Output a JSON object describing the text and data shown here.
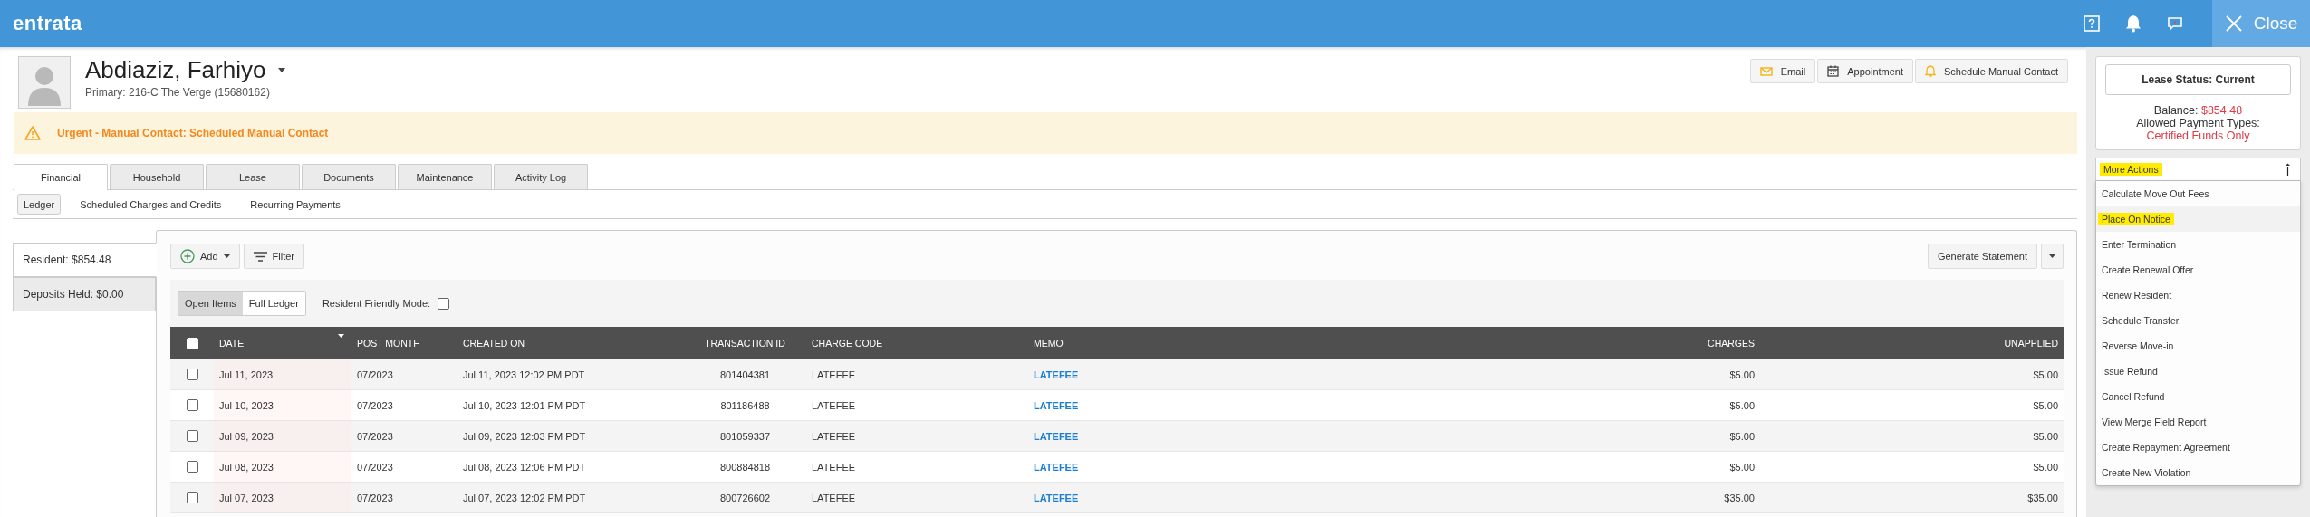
{
  "app_header": {
    "logo": "entrata",
    "close_label": "Close"
  },
  "resident": {
    "name": "Abdiaziz, Farhiyo",
    "primary": "Primary: 216-C The Verge (15680162)"
  },
  "contact_buttons": [
    {
      "kind": "email",
      "label": "Email"
    },
    {
      "kind": "calendar",
      "label": "Appointment"
    },
    {
      "kind": "bell",
      "label": "Schedule Manual Contact"
    }
  ],
  "alert": "Urgent - Manual Contact: Scheduled Manual Contact",
  "tabs": [
    {
      "label": "Financial",
      "selected": true
    },
    {
      "label": "Household",
      "selected": false
    },
    {
      "label": "Lease",
      "selected": false
    },
    {
      "label": "Documents",
      "selected": false
    },
    {
      "label": "Maintenance",
      "selected": false
    },
    {
      "label": "Activity Log",
      "selected": false
    }
  ],
  "subtabs": [
    {
      "label": "Ledger",
      "selected": true
    },
    {
      "label": "Scheduled Charges and Credits",
      "selected": false
    },
    {
      "label": "Recurring Payments",
      "selected": false
    }
  ],
  "balances": [
    {
      "label": "Resident: $854.48",
      "selected": true
    },
    {
      "label": "Deposits Held: $0.00",
      "selected": false
    }
  ],
  "toolbar": {
    "add": "Add",
    "filter": "Filter",
    "generate": "Generate Statement"
  },
  "ledger_toggle": [
    {
      "label": "Open Items",
      "selected": true
    },
    {
      "label": "Full Ledger",
      "selected": false
    }
  ],
  "resident_friendly_mode": {
    "label": "Resident Friendly Mode:",
    "checked": false
  },
  "table": {
    "select_all_checked": false,
    "columns": [
      "DATE",
      "POST MONTH",
      "CREATED ON",
      "TRANSACTION ID",
      "CHARGE CODE",
      "MEMO",
      "CHARGES",
      "UNAPPLIED"
    ],
    "rows": [
      {
        "checked": false,
        "cells": [
          "Jul 11, 2023",
          "07/2023",
          "Jul 11, 2023 12:02 PM PDT",
          "801404381",
          "LATEFEE",
          "LATEFEE",
          "$5.00",
          "$5.00"
        ]
      },
      {
        "checked": false,
        "cells": [
          "Jul 10, 2023",
          "07/2023",
          "Jul 10, 2023 12:01 PM PDT",
          "801186488",
          "LATEFEE",
          "LATEFEE",
          "$5.00",
          "$5.00"
        ]
      },
      {
        "checked": false,
        "cells": [
          "Jul 09, 2023",
          "07/2023",
          "Jul 09, 2023 12:03 PM PDT",
          "801059337",
          "LATEFEE",
          "LATEFEE",
          "$5.00",
          "$5.00"
        ]
      },
      {
        "checked": false,
        "cells": [
          "Jul 08, 2023",
          "07/2023",
          "Jul 08, 2023 12:06 PM PDT",
          "800884818",
          "LATEFEE",
          "LATEFEE",
          "$5.00",
          "$5.00"
        ]
      },
      {
        "checked": false,
        "cells": [
          "Jul 07, 2023",
          "07/2023",
          "Jul 07, 2023 12:02 PM PDT",
          "800726602",
          "LATEFEE",
          "LATEFEE",
          "$35.00",
          "$35.00"
        ]
      }
    ]
  },
  "lease_card": {
    "status": "Lease Status: Current",
    "balance_label": "Balance:",
    "balance_value": "$854.48",
    "payment_label": "Allowed Payment Types:",
    "payment_value": "Certified Funds Only"
  },
  "more_actions": {
    "label": "More Actions",
    "highlighted": true
  },
  "actions": [
    {
      "label": "Calculate Move Out Fees",
      "highlighted": false
    },
    {
      "label": "Place On Notice",
      "highlighted": true
    },
    {
      "label": "Enter Termination",
      "highlighted": false
    },
    {
      "label": "Create Renewal Offer",
      "highlighted": false
    },
    {
      "label": "Renew Resident",
      "highlighted": false
    },
    {
      "label": "Schedule Transfer",
      "highlighted": false
    },
    {
      "label": "Reverse Move-in",
      "highlighted": false
    },
    {
      "label": "Issue Refund",
      "highlighted": false
    },
    {
      "label": "Cancel Refund",
      "highlighted": false
    },
    {
      "label": "View Merge Field Report",
      "highlighted": false
    },
    {
      "label": "Create Repayment Agreement",
      "highlighted": false
    },
    {
      "label": "Create New Violation",
      "highlighted": false
    }
  ]
}
